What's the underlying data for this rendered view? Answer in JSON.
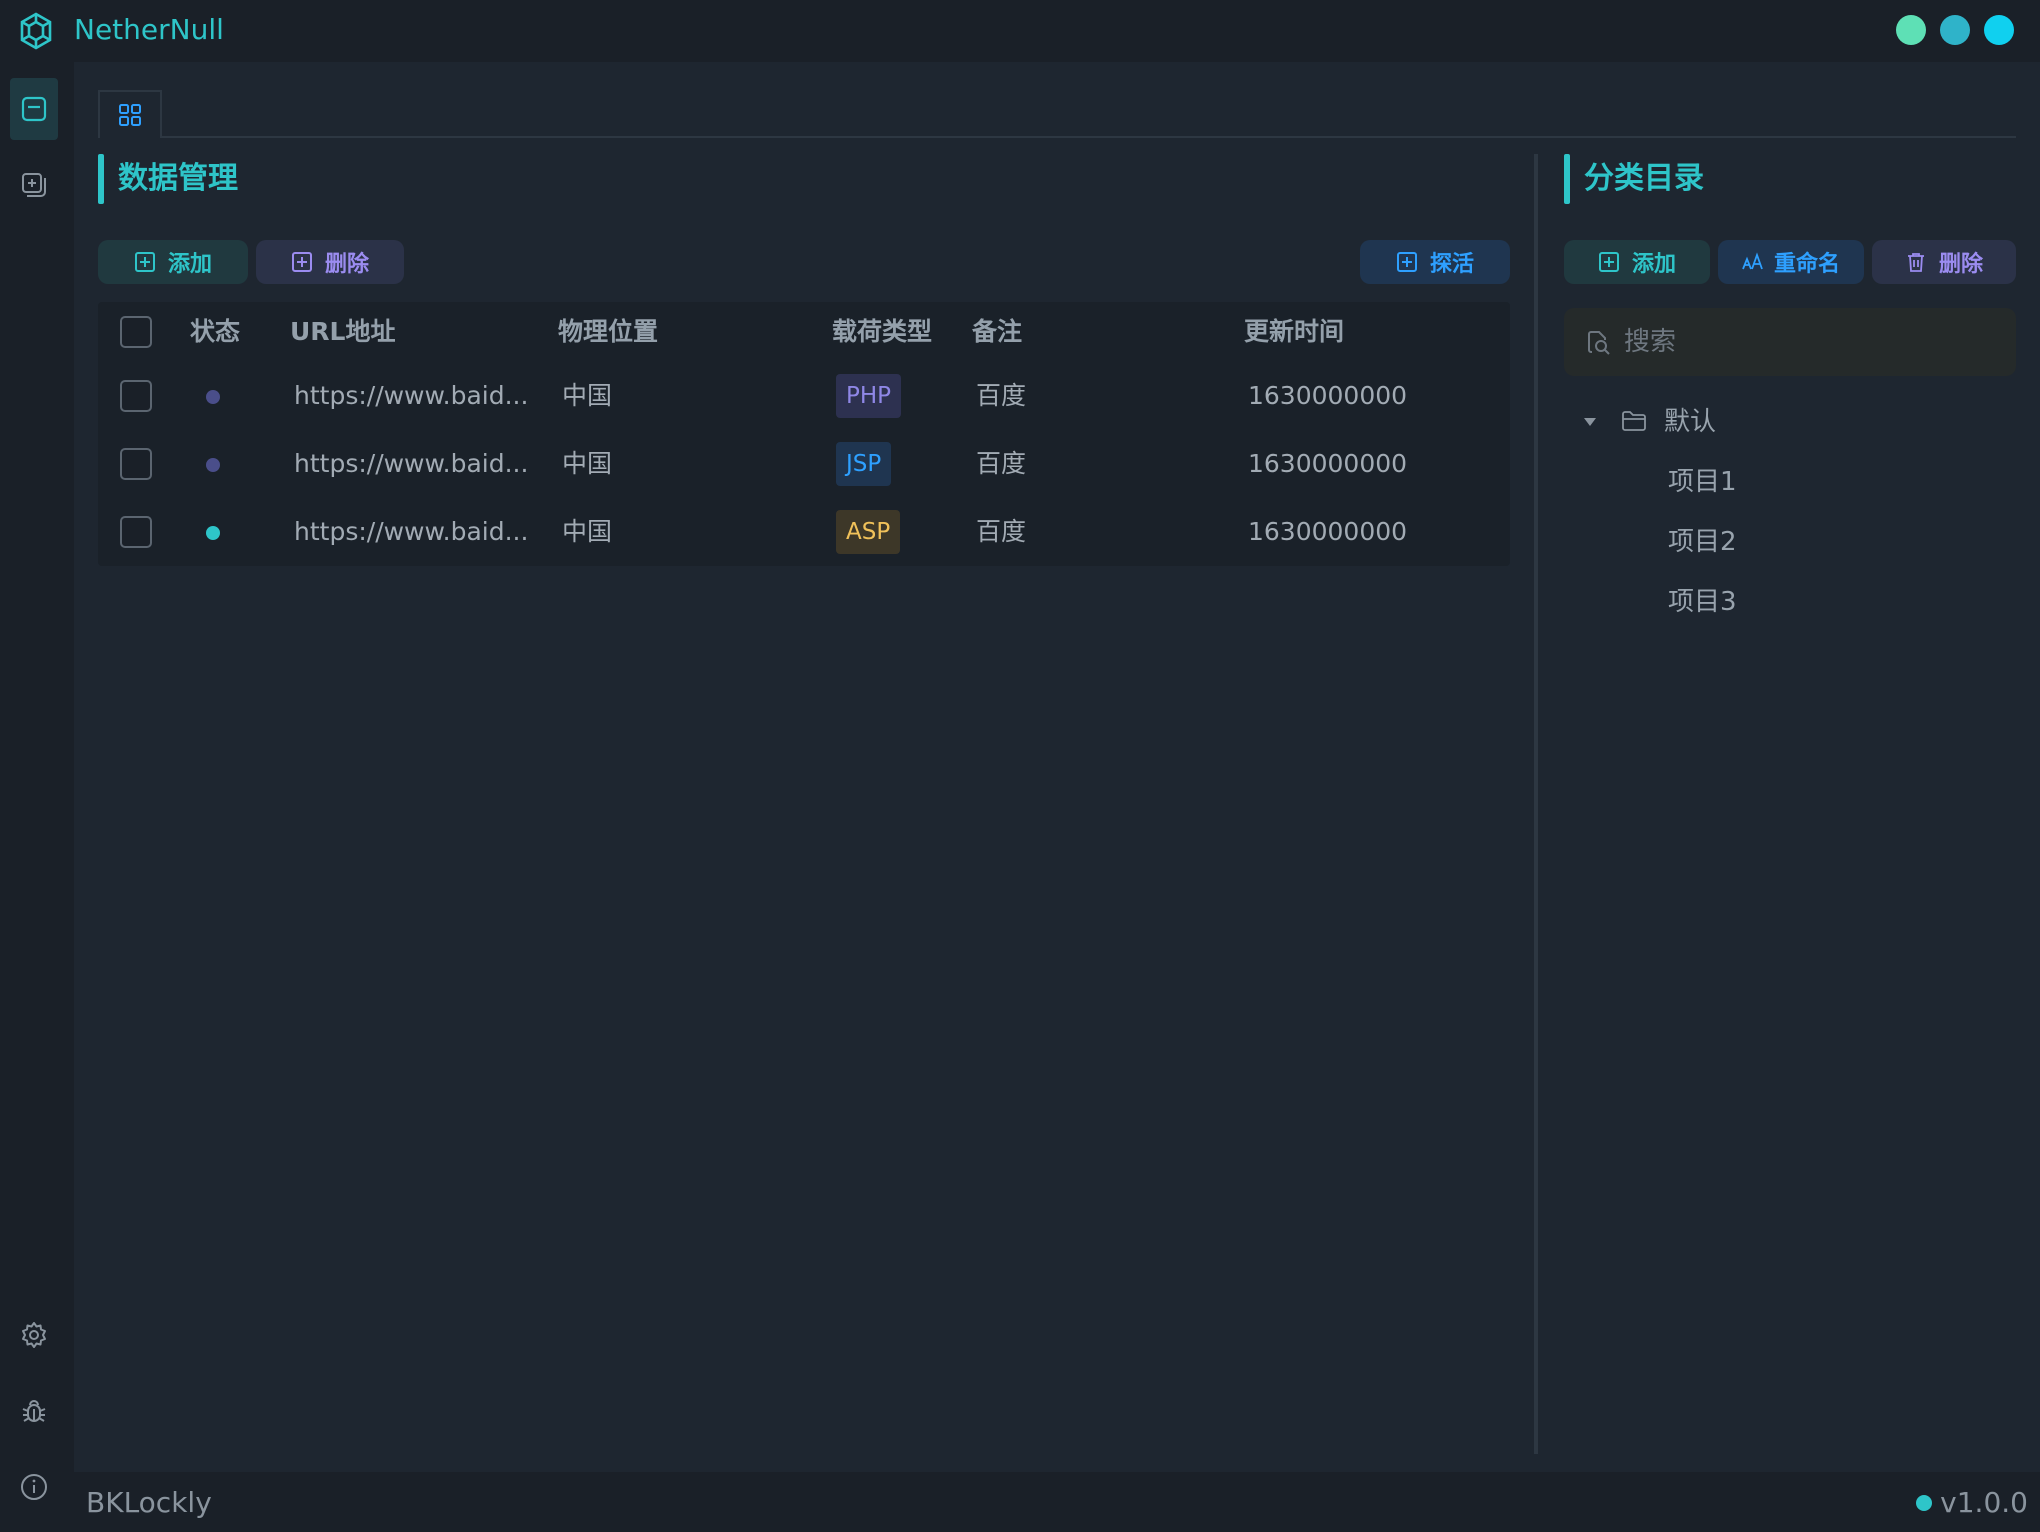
{
  "app": {
    "title": "NetherNull"
  },
  "window_controls": [
    {
      "name": "minimize",
      "color": "#5ee0b5"
    },
    {
      "name": "maximize",
      "color": "#2fb3c9"
    },
    {
      "name": "close",
      "color": "#10d0ef"
    }
  ],
  "sidebar": {
    "top_items": [
      {
        "icon": "data-panel-icon",
        "active": true
      },
      {
        "icon": "add-copy-icon",
        "active": false
      }
    ],
    "bottom_items": [
      {
        "icon": "gear-icon"
      },
      {
        "icon": "bug-icon"
      },
      {
        "icon": "info-icon"
      }
    ]
  },
  "tabs": [
    {
      "icon": "grid-icon"
    }
  ],
  "data_panel": {
    "title": "数据管理",
    "add_label": "添加",
    "delete_label": "删除",
    "probe_label": "探活",
    "columns": [
      "状态",
      "URL地址",
      "物理位置",
      "载荷类型",
      "备注",
      "更新时间"
    ],
    "rows": [
      {
        "status_color": "#4a4e8a",
        "url": "https://www.baid...",
        "location": "中国",
        "payload": "PHP",
        "remark": "百度",
        "updated": "1630000000"
      },
      {
        "status_color": "#4a4e8a",
        "url": "https://www.baid...",
        "location": "中国",
        "payload": "JSP",
        "remark": "百度",
        "updated": "1630000000"
      },
      {
        "status_color": "#2ec5c9",
        "url": "https://www.baid...",
        "location": "中国",
        "payload": "ASP",
        "remark": "百度",
        "updated": "1630000000"
      }
    ]
  },
  "category_panel": {
    "title": "分类目录",
    "add_label": "添加",
    "rename_label": "重命名",
    "delete_label": "删除",
    "search_placeholder": "搜索",
    "tree": {
      "root_label": "默认",
      "children": [
        "项目1",
        "项目2",
        "项目3"
      ]
    }
  },
  "footer": {
    "user": "BKLockly",
    "version": "v1.0.0",
    "status_color": "#2ec5c9"
  },
  "colors": {
    "accent": "#2ec5c9",
    "php_tag_bg": "#2d3150",
    "php_tag_fg": "#8f87e6",
    "jsp_tag_bg": "#1f3550",
    "jsp_tag_fg": "#2ea0ff",
    "asp_tag_bg": "#3d3728",
    "asp_tag_fg": "#f0c15a"
  }
}
